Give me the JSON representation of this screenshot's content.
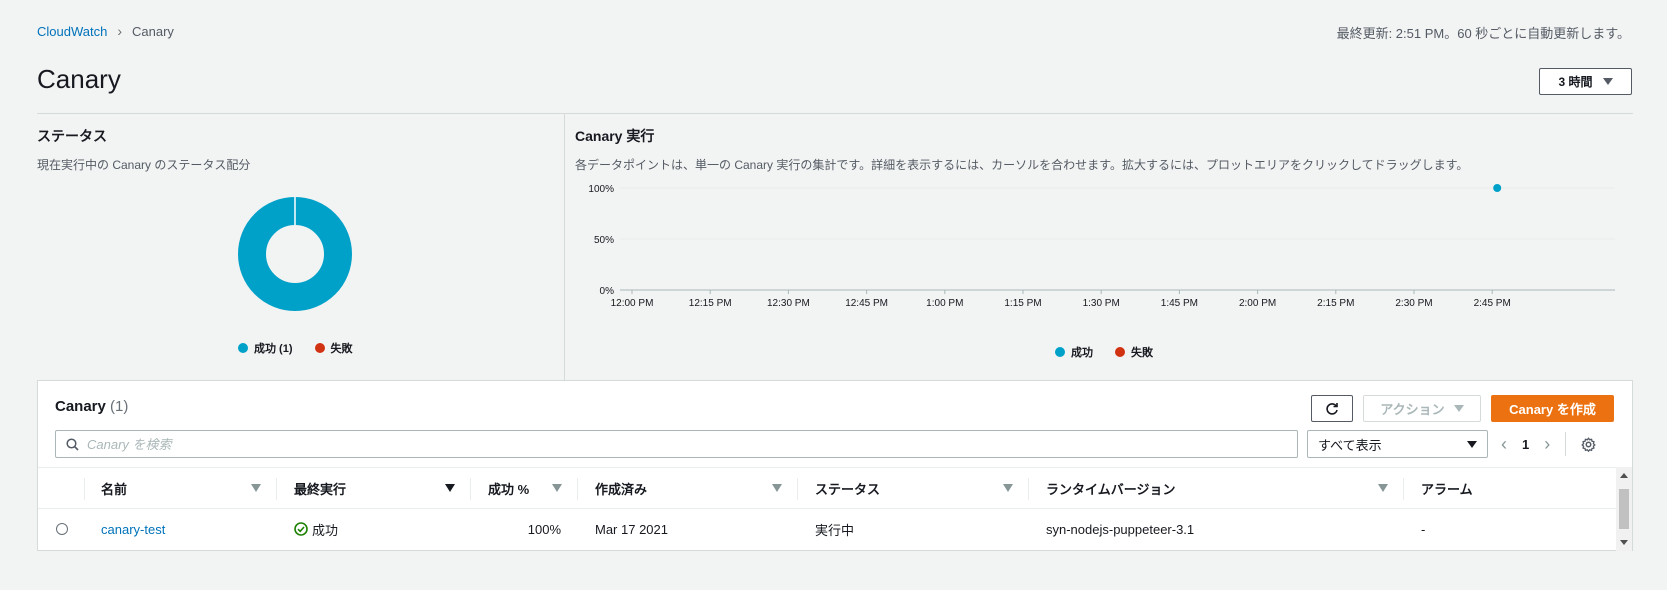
{
  "breadcrumb": {
    "root": "CloudWatch",
    "current": "Canary"
  },
  "refresh_info": "最終更新: 2:51 PM。60 秒ごとに自動更新します。",
  "page": {
    "title": "Canary",
    "time_range": "3 時間"
  },
  "status_panel": {
    "title": "ステータス",
    "description": "現在実行中の Canary のステータス配分",
    "legend": [
      {
        "label": "成功 (1)",
        "color": "#00a1c9"
      },
      {
        "label": "失敗",
        "color": "#d13212"
      }
    ]
  },
  "runs_panel": {
    "title": "Canary 実行",
    "description": "各データポイントは、単一の Canary 実行の集計です。詳細を表示するには、カーソルを合わせます。拡大するには、プロットエリアをクリックしてドラッグします。",
    "legend": [
      {
        "label": "成功",
        "color": "#00a1c9"
      },
      {
        "label": "失敗",
        "color": "#d13212"
      }
    ]
  },
  "chart_data": [
    {
      "type": "pie",
      "categories": [
        "成功",
        "失敗"
      ],
      "values": [
        1,
        0
      ],
      "colors": [
        "#00a1c9",
        "#d13212"
      ],
      "donut": true
    },
    {
      "type": "scatter",
      "y_ticks": [
        "100%",
        "50%",
        "0%"
      ],
      "x_ticks": [
        "12:00 PM",
        "12:15 PM",
        "12:30 PM",
        "12:45 PM",
        "1:00 PM",
        "1:15 PM",
        "1:30 PM",
        "1:45 PM",
        "2:00 PM",
        "2:15 PM",
        "2:30 PM",
        "2:45 PM"
      ],
      "ylim": [
        0,
        100
      ],
      "series": [
        {
          "name": "成功",
          "color": "#00a1c9",
          "points": [
            {
              "x": "2:45 PM",
              "y": 100
            }
          ]
        },
        {
          "name": "失敗",
          "color": "#d13212",
          "points": []
        }
      ],
      "grid": true
    }
  ],
  "table": {
    "title": "Canary",
    "count": "(1)",
    "actions_label": "アクション",
    "create_label": "Canary を作成",
    "search_placeholder": "Canary を検索",
    "filter_value": "すべて表示",
    "page_number": "1",
    "columns": [
      "名前",
      "最終実行",
      "成功 %",
      "作成済み",
      "ステータス",
      "ランタイムバージョン",
      "アラーム"
    ],
    "rows": [
      {
        "name": "canary-test",
        "last_run": "成功",
        "success_pct": "100%",
        "created": "Mar 17 2021",
        "status": "実行中",
        "runtime": "syn-nodejs-puppeteer-3.1",
        "alarm": "-"
      }
    ]
  }
}
